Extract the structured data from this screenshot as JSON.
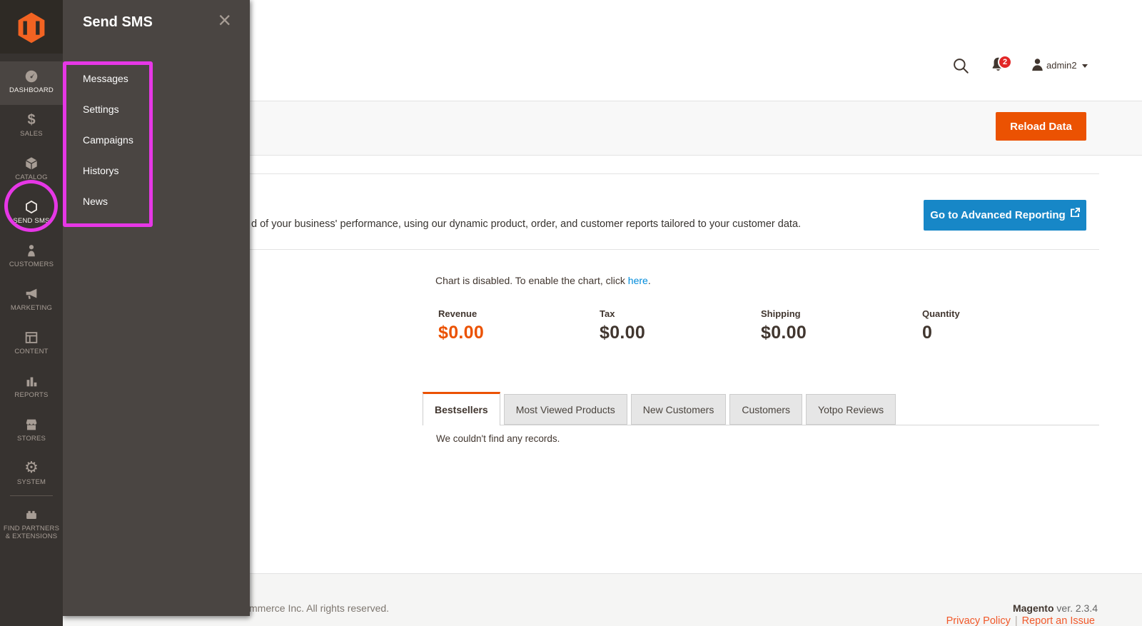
{
  "colors": {
    "sidebar_bg": "#373330",
    "flyout_bg": "#4a4542",
    "accent_orange": "#eb5202",
    "button_blue": "#1787c7",
    "link_blue": "#008bdb",
    "annotation_magenta": "#e637e6",
    "badge_red": "#e22626",
    "footer_link_orange": "#f1592a"
  },
  "icons": {
    "sales_glyph": "$",
    "system_glyph": "⚙",
    "close_glyph": "×"
  },
  "sidebar": {
    "items": [
      {
        "label": "DASHBOARD",
        "selected": true
      },
      {
        "label": "SALES"
      },
      {
        "label": "CATALOG"
      },
      {
        "label": "SEND SMS"
      },
      {
        "label": "CUSTOMERS"
      },
      {
        "label": "MARKETING"
      },
      {
        "label": "CONTENT"
      },
      {
        "label": "REPORTS"
      },
      {
        "label": "STORES"
      },
      {
        "label": "SYSTEM"
      },
      {
        "label": "FIND PARTNERS & EXTENSIONS"
      }
    ]
  },
  "flyout": {
    "title": "Send SMS",
    "items": [
      {
        "label": "Messages"
      },
      {
        "label": "Settings"
      },
      {
        "label": "Campaigns"
      },
      {
        "label": "Historys"
      },
      {
        "label": "News"
      }
    ]
  },
  "header": {
    "username": "admin2",
    "notification_count": "2"
  },
  "page_actions": {
    "reload_button": "Reload Data"
  },
  "advanced_reporting": {
    "description_visible": "d of your business' performance, using our dynamic product, order, and customer reports tailored to your customer data.",
    "button_label": "Go to Advanced Reporting"
  },
  "chart_note": {
    "text_before_link": "Chart is disabled. To enable the chart, click ",
    "link_text": "here",
    "text_after_link": "."
  },
  "stats": {
    "items": [
      {
        "label": "Revenue",
        "value": "$0.00"
      },
      {
        "label": "Tax",
        "value": "$0.00"
      },
      {
        "label": "Shipping",
        "value": "$0.00"
      },
      {
        "label": "Quantity",
        "value": "0"
      }
    ]
  },
  "dashboard_tabs": {
    "items": [
      {
        "label": "Bestsellers",
        "active": true
      },
      {
        "label": "Most Viewed Products"
      },
      {
        "label": "New Customers"
      },
      {
        "label": "Customers"
      },
      {
        "label": "Yotpo Reviews"
      }
    ],
    "empty_message": "We couldn't find any records."
  },
  "footer": {
    "copyright_visible": "mmerce Inc. All rights reserved.",
    "brand": "Magento",
    "version": " ver. 2.3.4",
    "privacy_link": "Privacy Policy",
    "separator": "|",
    "report_link": "Report an Issue"
  }
}
